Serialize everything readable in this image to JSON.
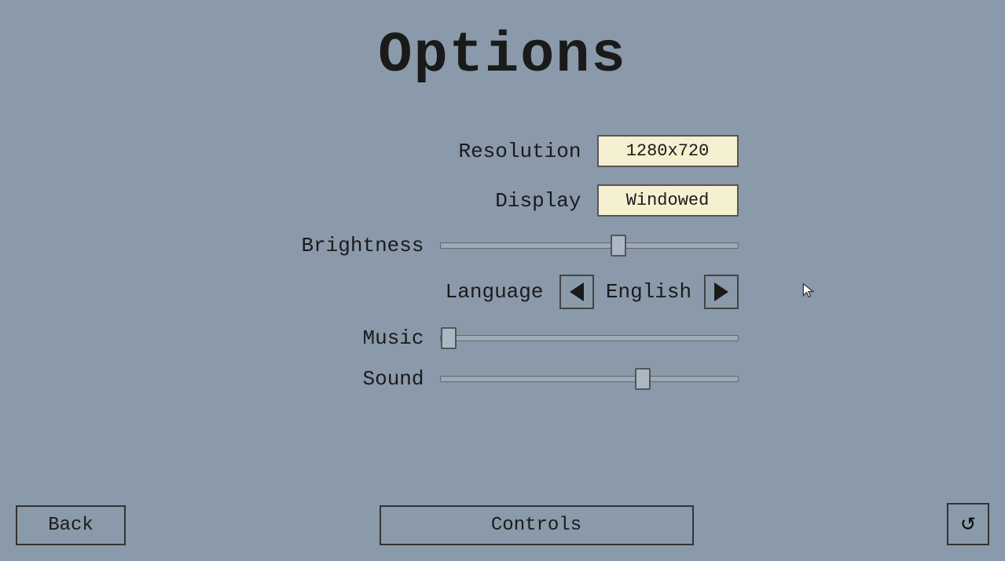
{
  "page": {
    "title": "Options",
    "background_color": "#8a9aaa"
  },
  "options": {
    "resolution": {
      "label": "Resolution",
      "value": "1280x720"
    },
    "display": {
      "label": "Display",
      "value": "Windowed"
    },
    "brightness": {
      "label": "Brightness",
      "value": 60,
      "min": 0,
      "max": 100
    },
    "language": {
      "label": "Language",
      "value": "English",
      "prev_label": "←",
      "next_label": "→"
    },
    "music": {
      "label": "Music",
      "value": 0,
      "min": 0,
      "max": 100
    },
    "sound": {
      "label": "Sound",
      "value": 68,
      "min": 0,
      "max": 100
    }
  },
  "buttons": {
    "back": "Back",
    "controls": "Controls",
    "reset_icon": "↺"
  }
}
